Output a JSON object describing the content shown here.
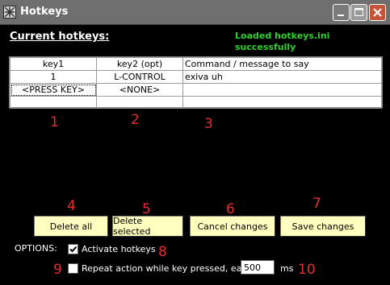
{
  "window": {
    "title": "Hotkeys",
    "controls": [
      "minimize",
      "maximize",
      "close"
    ]
  },
  "section_title": "Current hotkeys:",
  "status": "Loaded hotkeys.ini successfully",
  "table": {
    "columns": [
      "key1",
      "key2 (opt)",
      "Command / message to say"
    ],
    "rows": [
      [
        "1",
        "L-CONTROL",
        "exiva uh"
      ],
      [
        "<PRESS KEY>",
        "<NONE>",
        ""
      ],
      [
        "",
        "",
        ""
      ]
    ]
  },
  "markers": [
    "1",
    "2",
    "3",
    "4",
    "5",
    "6",
    "7",
    "8",
    "9",
    "10"
  ],
  "buttons": {
    "delete_all": "Delete all",
    "delete_selected": "Delete selected",
    "cancel_changes": "Cancel changes",
    "save_changes": "Save changes"
  },
  "options": {
    "label": "OPTIONS:",
    "activate_hotkeys": {
      "label": "Activate hotkeys",
      "checked": true
    },
    "repeat_action": {
      "label": "Repeat action while key pressed, each",
      "checked": false
    },
    "interval_value": "500",
    "interval_unit": "ms"
  },
  "colors": {
    "background": "#000000",
    "status_text": "#2fd12f",
    "button_face": "#ffffc0",
    "marker": "#e03030"
  }
}
